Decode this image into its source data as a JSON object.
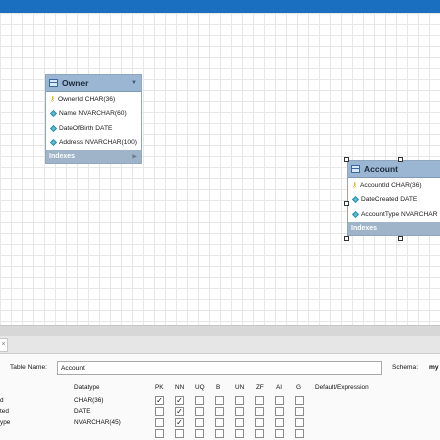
{
  "diagram": {
    "entities": [
      {
        "title": "Owner",
        "columns": [
          {
            "icon": "key-icon",
            "text": "OwnerId CHAR(36)"
          },
          {
            "icon": "diamond-icon",
            "text": "Name NVARCHAR(60)"
          },
          {
            "icon": "diamond-icon",
            "text": "DateOfBirth DATE"
          },
          {
            "icon": "diamond-icon",
            "text": "Address NVARCHAR(100)"
          }
        ],
        "footer": "Indexes"
      },
      {
        "title": "Account",
        "columns": [
          {
            "icon": "key-icon",
            "text": "AccountId CHAR(36)"
          },
          {
            "icon": "diamond-icon",
            "text": "DateCreated DATE"
          },
          {
            "icon": "diamond-icon",
            "text": "AccountType NVARCHAR"
          }
        ],
        "footer": "Indexes"
      }
    ]
  },
  "editor": {
    "tab_close": "×",
    "table_name_label": "Table Name:",
    "table_name_value": "Account",
    "schema_label": "Schema:",
    "schema_value": "my",
    "columns_header": {
      "datatype": "Datatype",
      "pk": "PK",
      "nn": "NN",
      "uq": "UQ",
      "b": "B",
      "un": "UN",
      "zf": "ZF",
      "ai": "AI",
      "g": "G",
      "default": "Default/Expression"
    },
    "rows": [
      {
        "name": "d",
        "datatype": "CHAR(36)",
        "flags": [
          true,
          true,
          false,
          false,
          false,
          false,
          false,
          false
        ]
      },
      {
        "name": "ted",
        "datatype": "DATE",
        "flags": [
          false,
          true,
          false,
          false,
          false,
          false,
          false,
          false
        ]
      },
      {
        "name": "ype",
        "datatype": "NVARCHAR(45)",
        "flags": [
          false,
          true,
          false,
          false,
          false,
          false,
          false,
          false
        ]
      },
      {
        "name": "",
        "datatype": "",
        "flags": [
          false,
          false,
          false,
          false,
          false,
          false,
          false,
          false
        ]
      }
    ]
  },
  "colors": {
    "accent": "#1b6fc0",
    "entity_header": "#9ab6d2",
    "entity_footer": "#9fb4c8"
  }
}
